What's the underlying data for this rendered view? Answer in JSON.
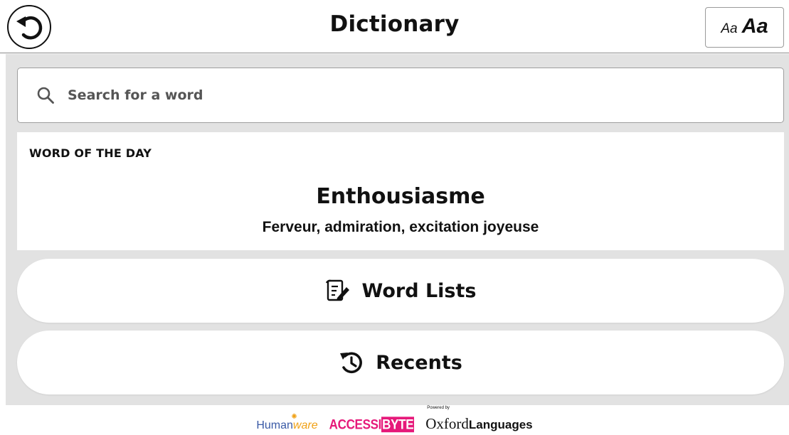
{
  "header": {
    "title": "Dictionary",
    "back_icon": "undo-arrow-icon",
    "font_size_small": "Aa",
    "font_size_large": "Aa"
  },
  "search": {
    "placeholder": "Search for a word",
    "value": "",
    "icon": "search-icon"
  },
  "word_of_the_day": {
    "label": "WORD OF THE DAY",
    "word": "Enthousiasme",
    "definition": "Ferveur, admiration, excitation joyeuse"
  },
  "menu": {
    "word_lists_label": "Word Lists",
    "word_lists_icon": "checklist-edit-icon",
    "recents_label": "Recents",
    "recents_icon": "history-icon"
  },
  "footer": {
    "humanware_human": "Human",
    "humanware_ware": "ware",
    "accessibyte_access": "ACCESSI",
    "accessibyte_byte": "BYTE",
    "oxford_powered": "Powered by",
    "oxford_name": "Oxford",
    "oxford_languages": "Languages"
  },
  "colors": {
    "panel_background": "#e2e2e2",
    "humanware_blue": "#3a5aa6",
    "humanware_orange": "#f0a116",
    "accessibyte_pink": "#e6197a"
  }
}
